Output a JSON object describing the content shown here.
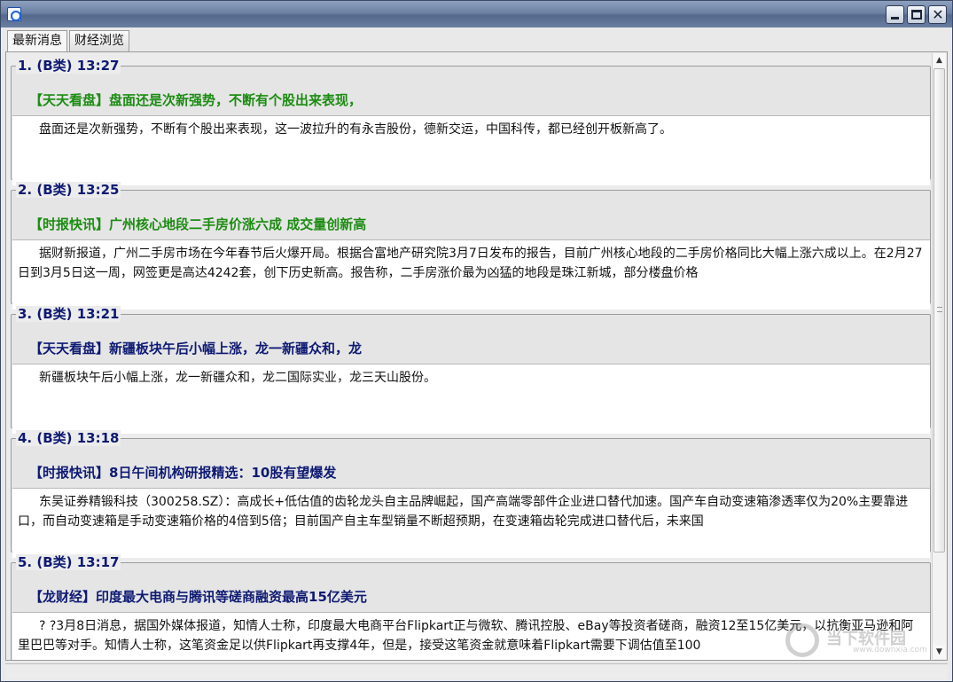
{
  "window": {
    "title": ""
  },
  "tabs": [
    {
      "label": "最新消息",
      "active": true
    },
    {
      "label": "财经浏览",
      "active": false
    }
  ],
  "news": [
    {
      "legend": "1. (B类)  13:27",
      "headline": "【天天看盘】盘面还是次新强势，不断有个股出来表现，",
      "headline_color": "green",
      "body": "盘面还是次新强势，不断有个股出来表现，这一波拉升的有永吉股份，德新交运，中国科传，都已经创开板新高了。"
    },
    {
      "legend": "2. (B类)  13:25",
      "headline": "【时报快讯】广州核心地段二手房价涨六成 成交量创新高",
      "headline_color": "green",
      "body": "据财新报道，广州二手房市场在今年春节后火爆开局。根据合富地产研究院3月7日发布的报告，目前广州核心地段的二手房价格同比大幅上涨六成以上。在2月27日到3月5日这一周，网签更是高达4242套，创下历史新高。报告称，二手房涨价最为凶猛的地段是珠江新城，部分楼盘价格"
    },
    {
      "legend": "3. (B类)  13:21",
      "headline": "【天天看盘】新疆板块午后小幅上涨，龙一新疆众和，龙",
      "headline_color": "navy",
      "body": "新疆板块午后小幅上涨，龙一新疆众和，龙二国际实业，龙三天山股份。"
    },
    {
      "legend": "4. (B类)  13:18",
      "headline": "【时报快讯】8日午间机构研报精选：10股有望爆发",
      "headline_color": "navy",
      "body": "东吴证券精锻科技（300258.SZ）：高成长+低估值的齿轮龙头自主品牌崛起，国产高端零部件企业进口替代加速。国产车自动变速箱渗透率仅为20%主要靠进口，而自动变速箱是手动变速箱价格的4倍到5倍；目前国产自主车型销量不断超预期，在变速箱齿轮完成进口替代后，未来国"
    },
    {
      "legend": "5. (B类)  13:17",
      "headline": "【龙财经】印度最大电商与腾讯等磋商融资最高15亿美元",
      "headline_color": "navy",
      "body": "? ?3月8日消息，据国外媒体报道，知情人士称，印度最大电商平台Flipkart正与微软、腾讯控股、eBay等投资者磋商，融资12至15亿美元，以抗衡亚马逊和阿里巴巴等对手。知情人士称，这笔资金足以供Flipkart再支撑4年，但是，接受这笔资金就意味着Flipkart需要下调估值至100"
    }
  ],
  "watermark": {
    "text": "当下软件园",
    "url": "www.downxia.com"
  },
  "colors": {
    "headline_green": "#1c8c12",
    "headline_navy": "#0e1a73",
    "legend": "#0e1a73"
  }
}
